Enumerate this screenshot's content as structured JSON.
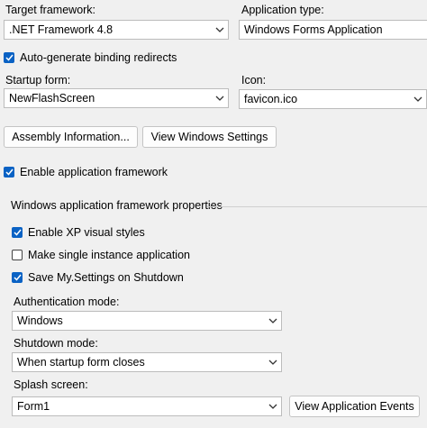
{
  "target_framework": {
    "label": "Target framework:",
    "value": ".NET Framework 4.8"
  },
  "application_type": {
    "label": "Application type:",
    "value": "Windows Forms Application"
  },
  "auto_binding": {
    "label": "Auto-generate binding redirects",
    "checked": true
  },
  "startup_form": {
    "label": "Startup form:",
    "value": "NewFlashScreen"
  },
  "icon": {
    "label": "Icon:",
    "value": "favicon.ico"
  },
  "buttons": {
    "assembly_info": "Assembly Information...",
    "view_windows_settings": "View Windows Settings",
    "view_app_events": "View Application Events"
  },
  "enable_framework": {
    "label": "Enable application framework",
    "checked": true
  },
  "framework_props": {
    "title": "Windows application framework properties",
    "xp_styles": {
      "label": "Enable XP visual styles",
      "checked": true
    },
    "single_instance": {
      "label": "Make single instance application",
      "checked": false
    },
    "save_settings": {
      "label": "Save My.Settings on Shutdown",
      "checked": true
    },
    "auth_mode": {
      "label": "Authentication mode:",
      "value": "Windows"
    },
    "shutdown_mode": {
      "label": "Shutdown mode:",
      "value": "When startup form closes"
    },
    "splash_screen": {
      "label": "Splash screen:",
      "value": "Form1"
    }
  },
  "icons": {
    "dropdown": "chevron-down-icon",
    "check": "checkmark-icon"
  },
  "colors": {
    "accent": "#0a62c4",
    "background": "#f0f0f0"
  }
}
